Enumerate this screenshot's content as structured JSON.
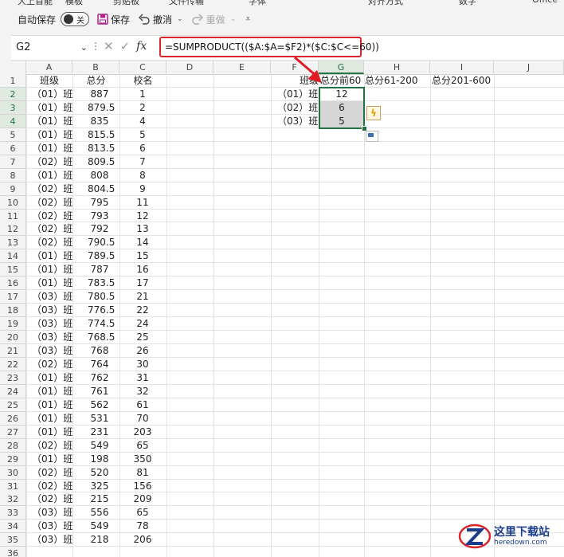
{
  "top_cut": [
    "大上首能",
    "模板",
    "剪贴板",
    "文件传输",
    "字体",
    "对齐方式",
    "数字",
    "Office"
  ],
  "qat": {
    "autosave_label": "自动保存",
    "toggle_label": "关",
    "save_label": "保存",
    "undo_label": "撤消",
    "redo_label": "重做"
  },
  "formula_bar": {
    "cell_ref": "G2",
    "fx": "fx",
    "formula": "=SUMPRODUCT(($A:$A=$F2)*($C:$C<=60))"
  },
  "columns": [
    "A",
    "B",
    "C",
    "D",
    "E",
    "F",
    "G",
    "H",
    "I",
    "J"
  ],
  "selected_column": "G",
  "header_row": {
    "a": "班级",
    "b": "总分",
    "c": "校名",
    "f": "班级",
    "g": "总分前60",
    "h": "总分61-200",
    "i": "总分201-600"
  },
  "rows": [
    [
      "（01）班",
      "887",
      "1"
    ],
    [
      "（01）班",
      "879.5",
      "2"
    ],
    [
      "（01）班",
      "835",
      "4"
    ],
    [
      "（01）班",
      "815.5",
      "5"
    ],
    [
      "（01）班",
      "813.5",
      "6"
    ],
    [
      "（02）班",
      "809.5",
      "7"
    ],
    [
      "（01）班",
      "808",
      "8"
    ],
    [
      "（02）班",
      "804.5",
      "9"
    ],
    [
      "（02）班",
      "795",
      "11"
    ],
    [
      "（02）班",
      "793",
      "12"
    ],
    [
      "（02）班",
      "792",
      "13"
    ],
    [
      "（02）班",
      "790.5",
      "14"
    ],
    [
      "（01）班",
      "789.5",
      "15"
    ],
    [
      "（01）班",
      "787",
      "16"
    ],
    [
      "（01）班",
      "783.5",
      "17"
    ],
    [
      "（03）班",
      "780.5",
      "21"
    ],
    [
      "（03）班",
      "776.5",
      "22"
    ],
    [
      "（03）班",
      "774.5",
      "24"
    ],
    [
      "（03）班",
      "768.5",
      "25"
    ],
    [
      "（03）班",
      "768",
      "26"
    ],
    [
      "（02）班",
      "764",
      "30"
    ],
    [
      "（01）班",
      "762",
      "31"
    ],
    [
      "（01）班",
      "761",
      "32"
    ],
    [
      "（01）班",
      "562",
      "61"
    ],
    [
      "（01）班",
      "531",
      "70"
    ],
    [
      "（01）班",
      "231",
      "203"
    ],
    [
      "（02）班",
      "549",
      "65"
    ],
    [
      "（01）班",
      "198",
      "350"
    ],
    [
      "（02）班",
      "520",
      "81"
    ],
    [
      "（02）班",
      "325",
      "156"
    ],
    [
      "（02）班",
      "215",
      "209"
    ],
    [
      "（03）班",
      "556",
      "65"
    ],
    [
      "（03）班",
      "549",
      "78"
    ],
    [
      "（03）班",
      "218",
      "206"
    ]
  ],
  "summary": [
    {
      "cls": "（01）班",
      "g": "12"
    },
    {
      "cls": "（02）班",
      "g": "6"
    },
    {
      "cls": "（03）班",
      "g": "5"
    }
  ],
  "watermark": {
    "title": "这里下载站",
    "url": "heredown.com"
  }
}
